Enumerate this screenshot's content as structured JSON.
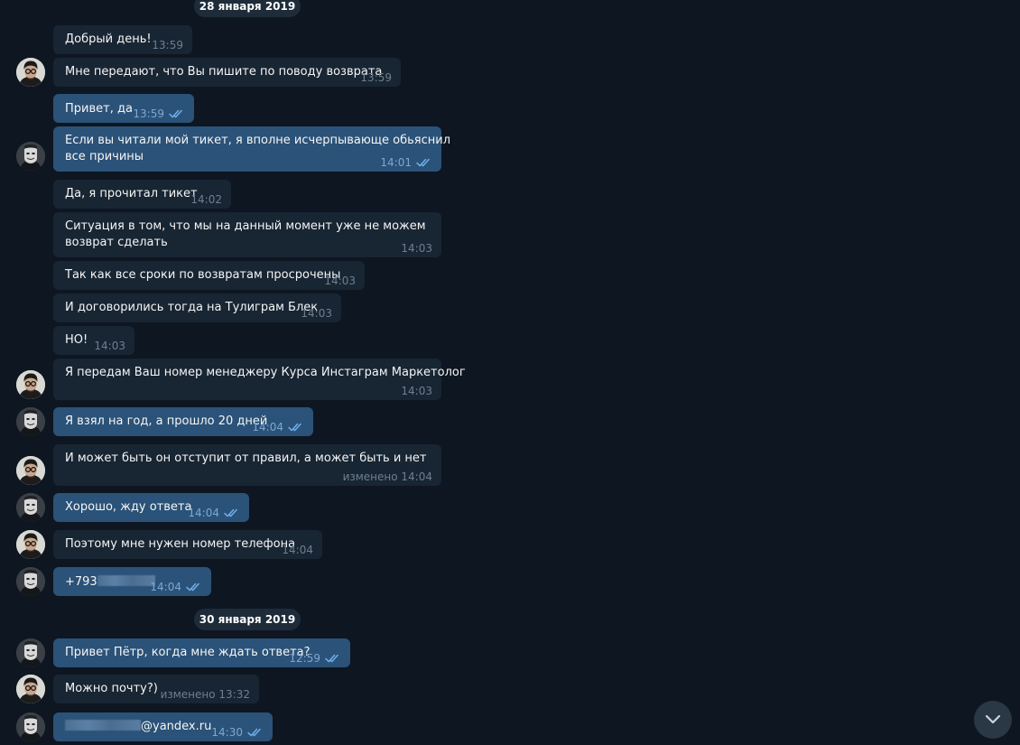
{
  "dates": [
    "28 января 2019",
    "30 января 2019"
  ],
  "messages": [
    {
      "text": "Добрый день!",
      "time": "13:59"
    },
    {
      "text": "Мне передают, что Вы пишите по поводу возврата",
      "time": "13:59"
    },
    {
      "text": "Привет, да",
      "time": "13:59"
    },
    {
      "text_line1": "Если вы читали мой тикет, я вполне исчерпывающе обьяснил",
      "text_line2": "все причины",
      "time": "14:01"
    },
    {
      "text": "Да, я прочитал тикет",
      "time": "14:02"
    },
    {
      "text_line1": "Ситуация в том, что мы на данный момент уже не можем",
      "text_line2": "возврат сделать",
      "time": "14:03"
    },
    {
      "text": "Так как все сроки по возвратам просрочены",
      "time": "14:03"
    },
    {
      "text": "И договорились тогда на Тулиграм Блек",
      "time": "14:03"
    },
    {
      "text": "НО!",
      "time": "14:03"
    },
    {
      "text": "Я передам Ваш номер менеджеру Курса Инстаграм Маркетолог",
      "time": "14:03"
    },
    {
      "text": "Я взял на год, а прошло 20 дней",
      "time": "14:04"
    },
    {
      "text": "И может быть он отступит от правил, а может быть и нет",
      "time": "изменено 14:04"
    },
    {
      "text": "Хорошо, жду ответа",
      "time": "14:04"
    },
    {
      "text": "Поэтому мне нужен номер телефона",
      "time": "14:04"
    },
    {
      "text": "+793",
      "time": "14:04"
    },
    {
      "text": "Привет Пётр, когда мне ждать ответа?",
      "time": "12:59"
    },
    {
      "text": "Можно почту?)",
      "time": "изменено 13:32"
    },
    {
      "text": "@yandex.ru",
      "time": "14:30"
    }
  ],
  "icons": {
    "read_receipt": "double-check-icon",
    "scroll_down": "chevron-down-icon",
    "avatar_interlocutor": "avatar-man-glasses",
    "avatar_self": "avatar-anonymous-mask"
  },
  "colors": {
    "background": "#0e1621",
    "incoming_bubble": "#182533",
    "outgoing_bubble": "#2b5278",
    "check": "#6eb0ef",
    "date_pill": "#1e2c3a"
  }
}
